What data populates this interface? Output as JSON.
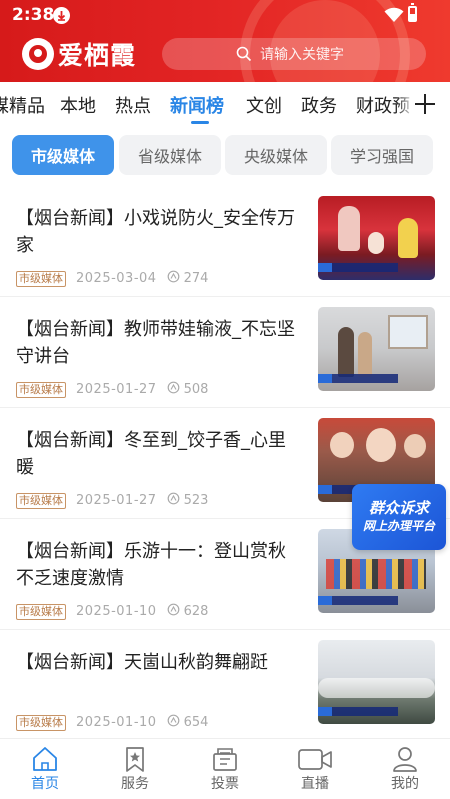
{
  "status_bar": {
    "time": "2:38"
  },
  "header": {
    "app_name": "爱栖霞",
    "search_placeholder": "请输入关键字"
  },
  "categories": [
    "媒精品",
    "本地",
    "热点",
    "新闻榜",
    "文创",
    "政务",
    "财政预"
  ],
  "active_category": "新闻榜",
  "sub_tabs": [
    "市级媒体",
    "省级媒体",
    "央级媒体",
    "学习强国"
  ],
  "active_sub_tab": "市级媒体",
  "news": [
    {
      "title": "【烟台新闻】小戏说防火_安全传万家",
      "badge": "市级媒体",
      "date": "2025-03-04",
      "views": "274"
    },
    {
      "title": "【烟台新闻】教师带娃输液_不忘坚守讲台",
      "badge": "市级媒体",
      "date": "2025-01-27",
      "views": "508"
    },
    {
      "title": "【烟台新闻】冬至到_饺子香_心里暖",
      "badge": "市级媒体",
      "date": "2025-01-27",
      "views": "523"
    },
    {
      "title": "【烟台新闻】乐游十一：登山赏秋 不乏速度激情",
      "badge": "市级媒体",
      "date": "2025-01-10",
      "views": "628"
    },
    {
      "title": "【烟台新闻】天崮山秋韵舞翩跹",
      "badge": "市级媒体",
      "date": "2025-01-10",
      "views": "654"
    }
  ],
  "float_badge": {
    "line1": "群众诉求",
    "line2": "网上办理平台"
  },
  "bottom_nav": [
    {
      "label": "首页",
      "icon": "home-icon"
    },
    {
      "label": "服务",
      "icon": "bookmark-star-icon"
    },
    {
      "label": "投票",
      "icon": "ballot-icon"
    },
    {
      "label": "直播",
      "icon": "video-camera-icon"
    },
    {
      "label": "我的",
      "icon": "person-icon"
    }
  ],
  "colors": {
    "brand_red": "#d61a1a",
    "accent_blue": "#2a86e6",
    "badge_brown": "#b87c4a"
  }
}
